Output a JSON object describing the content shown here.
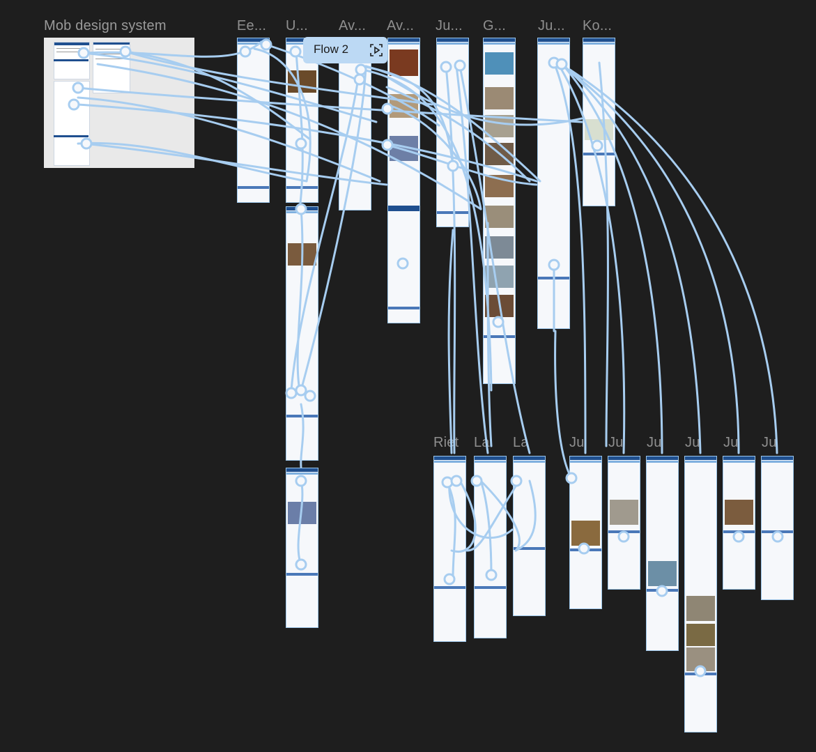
{
  "canvas": {
    "background": "#1e1e1e",
    "connector_color": "#a7cdf0",
    "frame_header_color": "#1f4f8f"
  },
  "design_system": {
    "title": "Mob design system"
  },
  "frame_titles": {
    "ee": "Ee...",
    "u": "U...",
    "av1": "Av...",
    "av2": "Av...",
    "ju1": "Ju...",
    "g": "G...",
    "ju2": "Ju...",
    "ko": "Ko...",
    "riet": "Riet",
    "la1": "La",
    "la2": "La",
    "ju3": "Ju",
    "ju4": "Ju",
    "ju5": "Ju",
    "ju6": "Ju",
    "ju7": "Ju",
    "ju8": "Ju"
  },
  "flow_badge": {
    "label": "Flow 2",
    "icon": "play-flow-icon"
  }
}
